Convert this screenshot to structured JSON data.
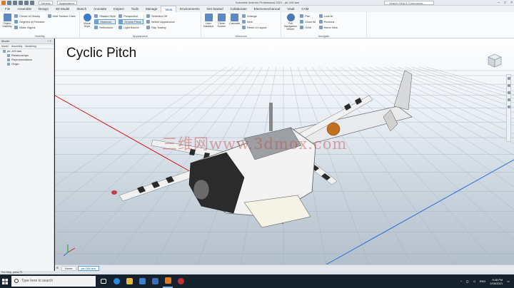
{
  "titlebar": {
    "app_title": "Autodesk Inventor Professional 2021 - ptr-100.iam",
    "material_combo": "Generic",
    "appearance_combo": "Appearance",
    "help_search": "Search Help & Commands...",
    "window_controls": [
      "–",
      "□",
      "×"
    ]
  },
  "ribbon_tabs": [
    "File",
    "Assemble",
    "Design",
    "3D Model",
    "Sketch",
    "Annotate",
    "Inspect",
    "Tools",
    "Manage",
    "View",
    "Environments",
    "Get Started",
    "Collaborate",
    "Electromechanical",
    "Vault",
    "CAM"
  ],
  "active_tab": "View",
  "ribbon": {
    "visibility": {
      "title": "Visibility",
      "big": "Object Visibility",
      "items": [
        "Center of Gravity",
        "Degrees of Freedom",
        "iMate Glyphs"
      ],
      "items2": [
        "Hide Surface Lines"
      ]
    },
    "appearance": {
      "title": "Appearance",
      "big": "Visual Style",
      "items": [
        "Shadows",
        "Reflections",
        "Ray Tracing"
      ],
      "items_left": [
        "Shaded Style",
        "Shadows",
        "Reflections"
      ],
      "items_mid": [
        "Perspective",
        "Ground Plane",
        "Light Source"
      ],
      "items_right": [
        "Realistic",
        "Technical",
        "Shaded"
      ],
      "items_far": [
        "Shaded Style",
        "Textures On",
        "Reflection"
      ]
    },
    "appearance_col2": [
      "Selection Off",
      "Before Appearance",
      "Ray Tracing"
    ],
    "windows": {
      "title": "Windows",
      "big": [
        "User Interface",
        "Clean Screen",
        "Cascade"
      ],
      "items": [
        "Arrange",
        "New",
        "Reset UI Layout"
      ]
    },
    "navigate": {
      "title": "Navigate",
      "big": "Full Navigation Wheel",
      "items": [
        "Pan",
        "Zoom All",
        "Orbit"
      ],
      "items2": [
        "Look At",
        "Previous",
        "Home View"
      ]
    }
  },
  "browser": {
    "title": "Model",
    "tabs": [
      "Model",
      "Assembly",
      "Modelling"
    ],
    "tree": [
      {
        "label": "ptr-100.iam",
        "child": false
      },
      {
        "label": "Relationships",
        "child": true
      },
      {
        "label": "Representations",
        "child": true
      },
      {
        "label": "Origin",
        "child": true
      }
    ]
  },
  "viewport": {
    "caption": "Cyclic Pitch",
    "watermark": "三维网www.3dmox.com"
  },
  "doc_tabs": [
    "Home",
    "ptr-100.iam"
  ],
  "active_doc_tab": "ptr-100.iam",
  "status_bar": "For Help, press F1",
  "taskbar": {
    "search_placeholder": "Type here to search",
    "language": "ENG",
    "time": "9:48 PM",
    "date": "2/18/2021"
  },
  "colors": {
    "accent": "#0d58a6",
    "x_axis": "#d32020",
    "y_axis": "#2a6fd8",
    "taskbar": "#16212e"
  }
}
